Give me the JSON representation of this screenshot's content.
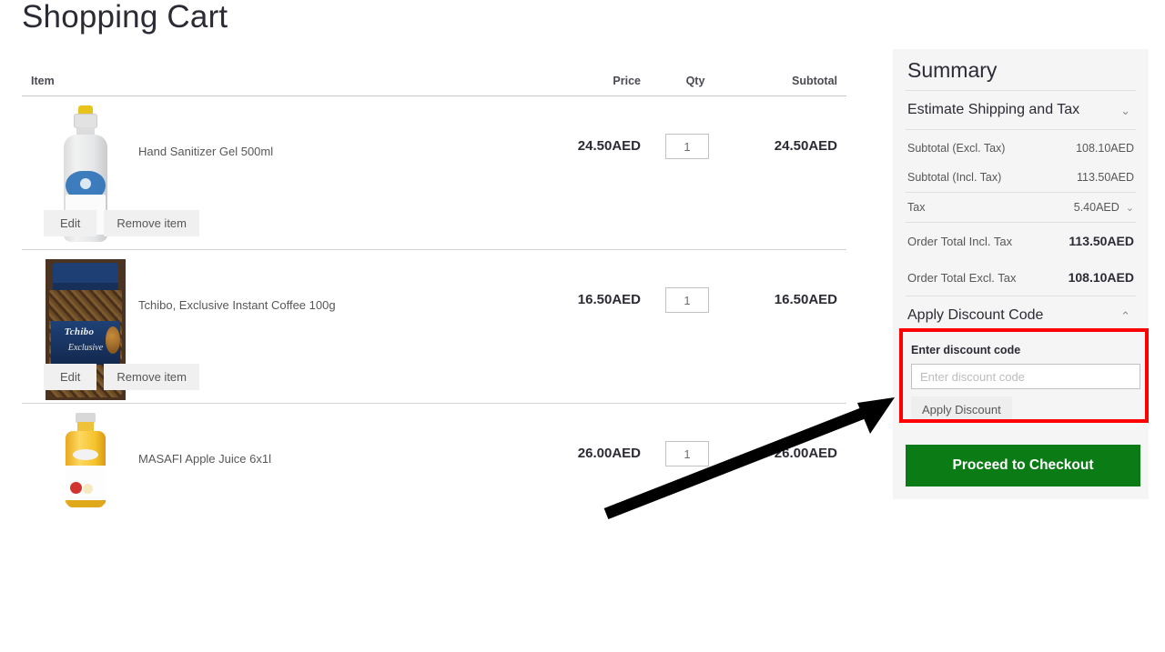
{
  "page": {
    "title": "Shopping Cart"
  },
  "cart": {
    "headers": {
      "item": "Item",
      "price": "Price",
      "qty": "Qty",
      "subtotal": "Subtotal"
    },
    "row_actions": {
      "edit": "Edit",
      "remove": "Remove item"
    },
    "items": [
      {
        "name": "Hand Sanitizer Gel 500ml",
        "price": "24.50AED",
        "qty": "1",
        "subtotal": "24.50AED",
        "image": "hand-sanitizer-bottle"
      },
      {
        "name": "Tchibo, Exclusive Instant Coffee 100g",
        "price": "16.50AED",
        "qty": "1",
        "subtotal": "16.50AED",
        "image": "tchibo-coffee-jar",
        "brand_text": "Tchibo",
        "brand_sub": "Exclusive"
      },
      {
        "name": "MASAFI Apple Juice 6x1l",
        "price": "26.00AED",
        "qty": "1",
        "subtotal": "26.00AED",
        "image": "masafi-apple-juice-bottle"
      }
    ]
  },
  "summary": {
    "title": "Summary",
    "estimate_shipping_label": "Estimate Shipping and Tax",
    "estimate_chevron": "⌄",
    "lines": [
      {
        "label": "Subtotal (Excl. Tax)",
        "value": "108.10AED"
      },
      {
        "label": "Subtotal (Incl. Tax)",
        "value": "113.50AED"
      },
      {
        "label": "Tax",
        "value": "5.40AED"
      },
      {
        "label": "Order Total Incl. Tax",
        "value": "113.50AED"
      },
      {
        "label": "Order Total Excl. Tax",
        "value": "108.10AED"
      }
    ],
    "tax_chevron": "⌄",
    "apply_discount_code_label": "Apply Discount Code",
    "apply_discount_chevron": "⌃",
    "discount": {
      "field_label": "Enter discount code",
      "input_placeholder": "Enter discount code",
      "input_value": "",
      "apply_button": "Apply Discount"
    },
    "checkout_button": "Proceed to Checkout"
  },
  "annotation": {
    "highlight_color": "#ff0000",
    "arrow_color": "#000000",
    "target": "discount-code-section"
  },
  "colors": {
    "checkout_green": "#0b7c15",
    "panel_bg": "#f5f5f5",
    "text_dark": "#2b2b35",
    "text_muted": "#575757"
  }
}
